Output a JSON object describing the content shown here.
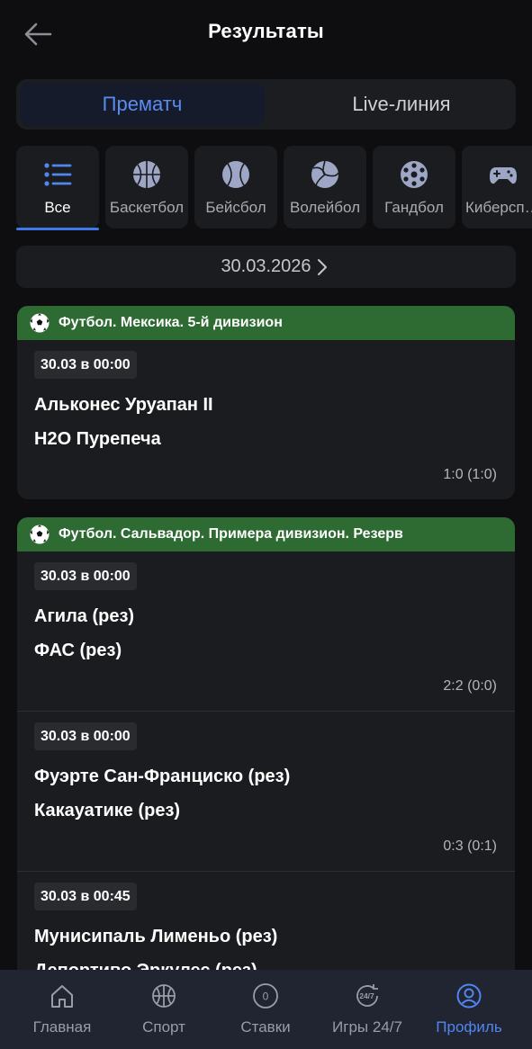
{
  "header": {
    "title": "Результаты",
    "back_icon": "arrow-left-icon"
  },
  "segments": {
    "prematch": "Прематч",
    "live": "Live-линия",
    "active": "prematch"
  },
  "sports": [
    {
      "label": "Все",
      "icon": "list-icon",
      "active": true
    },
    {
      "label": "Баскетбол",
      "icon": "basketball-icon"
    },
    {
      "label": "Бейсбол",
      "icon": "baseball-icon"
    },
    {
      "label": "Волейбол",
      "icon": "volleyball-icon"
    },
    {
      "label": "Гандбол",
      "icon": "handball-icon"
    },
    {
      "label": "Киберспорт",
      "icon": "gamepad-icon"
    }
  ],
  "date": {
    "value": "30.03.2026"
  },
  "leagues": [
    {
      "name": "Футбол. Мексика. 5-й дивизион",
      "matches": [
        {
          "time": "30.03 в 00:00",
          "team1": "Альконес Уруапан II",
          "team2": "H2O Пурепеча",
          "score": "1:0 (1:0)"
        }
      ]
    },
    {
      "name": "Футбол. Сальвадор. Примера дивизион. Резерв",
      "matches": [
        {
          "time": "30.03 в 00:00",
          "team1": "Агила (рез)",
          "team2": "ФАС (рез)",
          "score": "2:2 (0:0)"
        },
        {
          "time": "30.03 в 00:00",
          "team1": "Фуэрте Сан-Франциско (рез)",
          "team2": "Какауатике (рез)",
          "score": "0:3 (0:1)"
        },
        {
          "time": "30.03 в 00:45",
          "team1": "Мунисипаль Лименьо (рез)",
          "team2": "Депортиво Эркулес (рез)",
          "score": ""
        }
      ]
    }
  ],
  "nav": [
    {
      "label": "Главная",
      "icon": "home-icon"
    },
    {
      "label": "Спорт",
      "icon": "sport-ball-icon"
    },
    {
      "label": "Ставки",
      "icon": "bets-counter-icon",
      "badge": "0"
    },
    {
      "label": "Игры 24/7",
      "icon": "games-24-7-icon"
    },
    {
      "label": "Профиль",
      "icon": "profile-icon",
      "active": true
    }
  ],
  "colors": {
    "accent": "#4f86f0",
    "league_header": "#2d6b33",
    "background": "#0e0e10"
  }
}
